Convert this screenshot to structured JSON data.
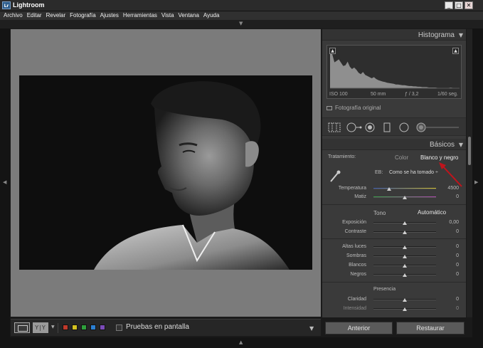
{
  "window": {
    "logo": "Lr",
    "title": "Lightroom",
    "controls": [
      "_",
      "□",
      "✕"
    ]
  },
  "menu": [
    "Archivo",
    "Editar",
    "Revelar",
    "Fotografía",
    "Ajustes",
    "Herramientas",
    "Vista",
    "Ventana",
    "Ayuda"
  ],
  "toolbar": {
    "yy_label": "Y|Y",
    "flag_colors": [
      "#c0392b",
      "#d4c220",
      "#2ea03c",
      "#2b7fd2",
      "#7b4bb8"
    ],
    "soft_proof_label": "Pruebas en pantalla"
  },
  "histogram": {
    "title": "Histograma",
    "iso": "ISO 100",
    "focal": "50 mm",
    "aperture": "ƒ / 3,2",
    "shutter": "1/60 seg.",
    "original_label": "Fotografía original",
    "levels": [
      0.95,
      0.92,
      0.7,
      0.74,
      0.78,
      0.69,
      0.6,
      0.62,
      0.72,
      0.58,
      0.52,
      0.56,
      0.5,
      0.42,
      0.38,
      0.44,
      0.36,
      0.33,
      0.3,
      0.27,
      0.3,
      0.25,
      0.22,
      0.2,
      0.18,
      0.17,
      0.15,
      0.14,
      0.13,
      0.12,
      0.1,
      0.1,
      0.09,
      0.08,
      0.08,
      0.07,
      0.06,
      0.06,
      0.05,
      0.05,
      0.04,
      0.04,
      0.03,
      0.03,
      0.03,
      0.02,
      0.02,
      0.02,
      0.02,
      0.01,
      0.01,
      0.01,
      0.01,
      0.01,
      0.01,
      0.02,
      0.01,
      0.01,
      0.01,
      0.01
    ]
  },
  "basic": {
    "title": "Básicos",
    "treatment_label": "Tratamiento:",
    "treatment_color": "Color",
    "treatment_bw": "Blanco y negro",
    "wb_label": "EB:",
    "wb_value": "Como se ha tomado ÷",
    "temp_label": "Temperatura",
    "temp_value": "4500",
    "temp_level": 0.25,
    "tint_label": "Matiz",
    "tint_value": "0",
    "tint_level": 0.5,
    "tone_label": "Tono",
    "auto_label": "Automático",
    "exposure_label": "Exposición",
    "exposure_value": "0,00",
    "contrast_label": "Contraste",
    "contrast_value": "0",
    "highlights_label": "Altas luces",
    "highlights_value": "0",
    "shadows_label": "Sombras",
    "shadows_value": "0",
    "whites_label": "Blancos",
    "whites_value": "0",
    "blacks_label": "Negros",
    "blacks_value": "0",
    "presence_label": "Presencia",
    "clarity_label": "Claridad",
    "clarity_value": "0",
    "vibrance_label": "Intensidad",
    "vibrance_value": "0"
  },
  "buttons": {
    "previous": "Anterior",
    "reset": "Restaurar"
  },
  "colors": {
    "annotation_arrow": "#c0141c",
    "panel_bg": "#3a3a3a",
    "canvas_bg": "#7b7b7b"
  }
}
